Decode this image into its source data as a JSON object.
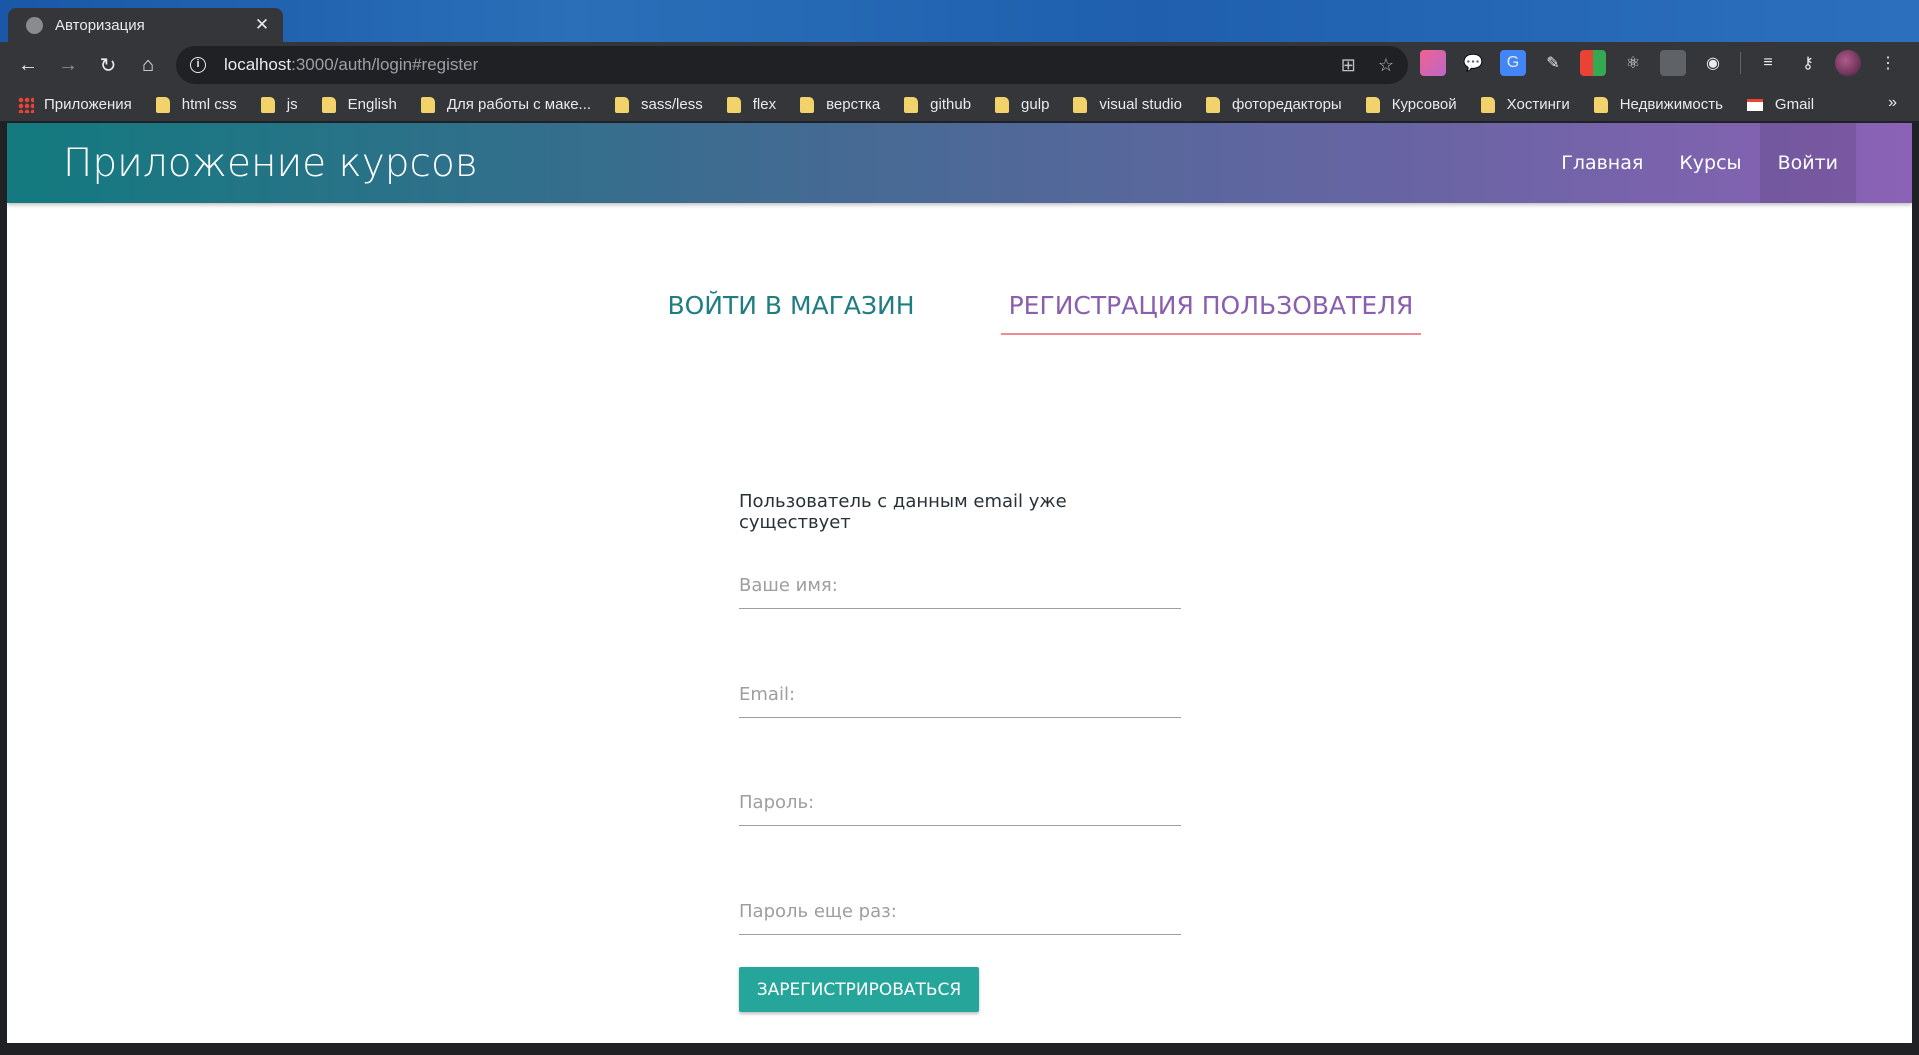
{
  "browser": {
    "tab_title": "Авторизация",
    "url_host": "localhost",
    "url_path": ":3000/auth/login#register",
    "bookmarks": [
      {
        "label": "Приложения",
        "type": "apps"
      },
      {
        "label": "html css",
        "type": "folder"
      },
      {
        "label": "js",
        "type": "folder"
      },
      {
        "label": "English",
        "type": "folder"
      },
      {
        "label": "Для работы с маке...",
        "type": "folder"
      },
      {
        "label": "sass/less",
        "type": "folder"
      },
      {
        "label": "flex",
        "type": "folder"
      },
      {
        "label": "верстка",
        "type": "folder"
      },
      {
        "label": "github",
        "type": "folder"
      },
      {
        "label": "gulp",
        "type": "folder"
      },
      {
        "label": "visual studio",
        "type": "folder"
      },
      {
        "label": "фоторедакторы",
        "type": "folder"
      },
      {
        "label": "Курсовой",
        "type": "folder"
      },
      {
        "label": "Хостинги",
        "type": "folder"
      },
      {
        "label": "Недвижимость",
        "type": "folder"
      },
      {
        "label": "Gmail",
        "type": "gmail"
      }
    ],
    "more_label": "»"
  },
  "appbar": {
    "brand": "Приложение курсов",
    "menu": [
      {
        "label": "Главная",
        "active": false
      },
      {
        "label": "Курсы",
        "active": false
      },
      {
        "label": "Войти",
        "active": true
      }
    ]
  },
  "tabs": {
    "login": "ВОЙТИ В МАГАЗИН",
    "register": "РЕГИСТРАЦИЯ ПОЛЬЗОВАТЕЛЯ"
  },
  "form": {
    "error": "Пользователь с данным email уже существует",
    "name_placeholder": "Ваше имя:",
    "email_placeholder": "Email:",
    "password_placeholder": "Пароль:",
    "password2_placeholder": "Пароль еще раз:",
    "submit": "ЗАРЕГИСТРИРОВАТЬСЯ"
  },
  "colors": {
    "teal": "#26a69a",
    "tab_login": "#1f7d83",
    "tab_register": "#8a5fb0",
    "tab_indicator": "#f28b8f"
  }
}
